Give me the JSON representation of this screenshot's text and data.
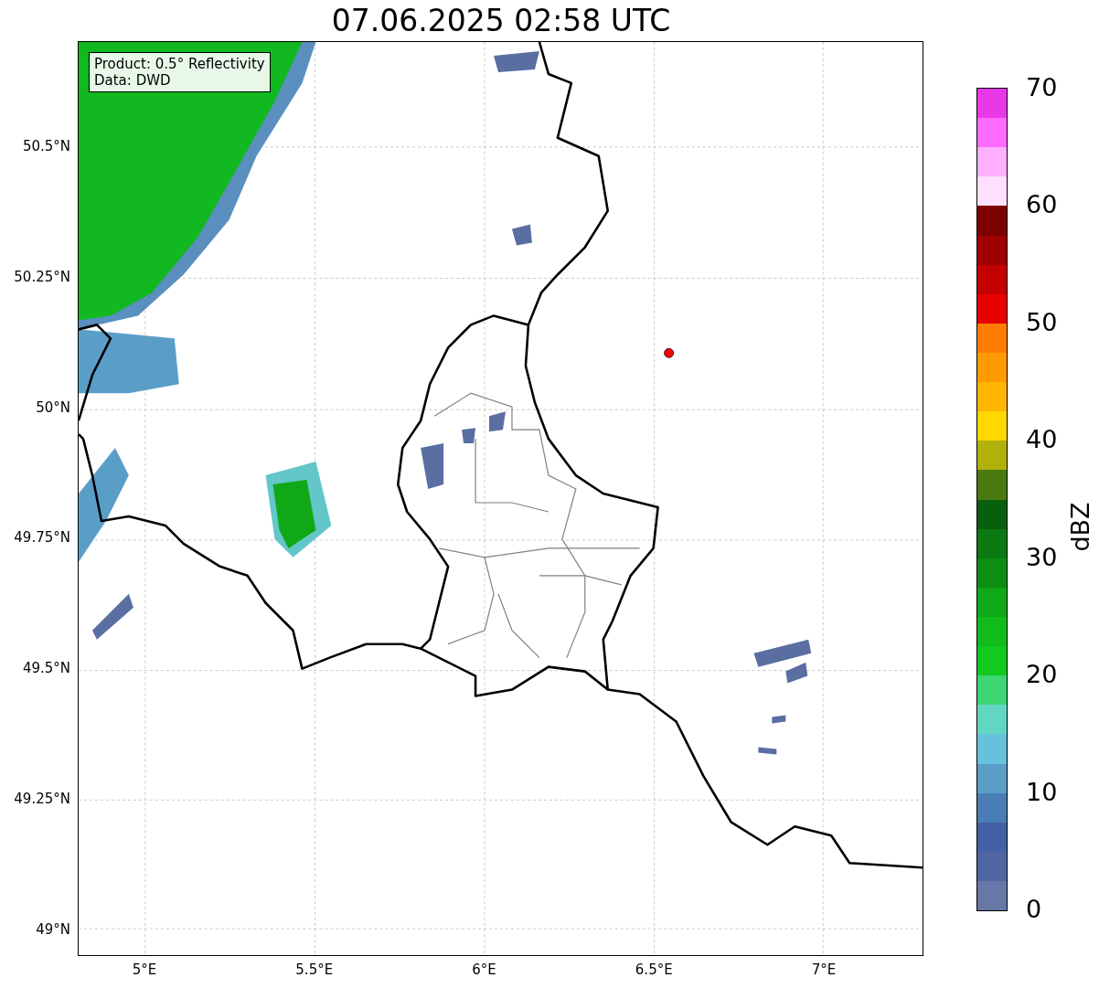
{
  "title": "07.06.2025 02:58 UTC",
  "info_box": {
    "lines": [
      "Product: 0.5° Reflectivity",
      "Data: DWD"
    ]
  },
  "y_axis": {
    "ticks": [
      "50.5°N",
      "50.25°N",
      "50°N",
      "49.75°N",
      "49.5°N",
      "49.25°N",
      "49°N"
    ]
  },
  "x_axis": {
    "ticks": [
      "5°E",
      "5.5°E",
      "6°E",
      "6.5°E",
      "7°E"
    ]
  },
  "colorbar": {
    "label": "dBZ",
    "ticks": [
      "70",
      "60",
      "50",
      "40",
      "30",
      "20",
      "10",
      "0"
    ]
  }
}
